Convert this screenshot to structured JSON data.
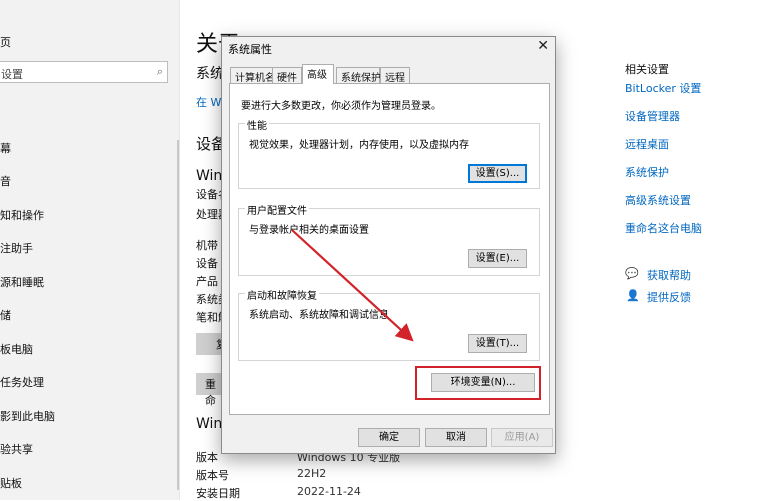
{
  "sidebar": {
    "page_frag": "页",
    "search_placeholder": "设置",
    "items": [
      "幕",
      "音",
      "知和操作",
      "注助手",
      "源和睡眠",
      "储",
      "板电脑",
      "任务处理",
      "影到此电脑",
      "验共享",
      "贴板"
    ]
  },
  "main": {
    "title_frag": "关于",
    "sub_frag": "系统",
    "link_frag": "在 Wi",
    "device_head": "设备",
    "spec_frag": "Win",
    "spec_rows": [
      "设备名",
      "处理器",
      "机带",
      "设备",
      "产品",
      "系统类",
      "笔和触"
    ],
    "copy_btn": "复",
    "rename_btn": "重命",
    "win_head": "Wind",
    "win_rows": [
      {
        "label": "版本",
        "value": "Windows 10 专业版"
      },
      {
        "label": "版本号",
        "value": "22H2"
      },
      {
        "label": "安装日期",
        "value": "2022-11-24"
      }
    ]
  },
  "right": {
    "heading": "相关设置",
    "links": [
      "BitLocker 设置",
      "设备管理器",
      "远程桌面",
      "系统保护",
      "高级系统设置",
      "重命名这台电脑"
    ],
    "help": "获取帮助",
    "feedback": "提供反馈"
  },
  "dialog": {
    "title": "系统属性",
    "close": "✕",
    "tabs": [
      "计算机名",
      "硬件",
      "高级",
      "系统保护",
      "远程"
    ],
    "active_tab": "高级",
    "admin_note": "要进行大多数更改，你必须作为管理员登录。",
    "groups": [
      {
        "label": "性能",
        "desc": "视觉效果，处理器计划，内存使用，以及虚拟内存",
        "button": "设置(S)..."
      },
      {
        "label": "用户配置文件",
        "desc": "与登录帐户相关的桌面设置",
        "button": "设置(E)..."
      },
      {
        "label": "启动和故障恢复",
        "desc": "系统启动、系统故障和调试信息",
        "button": "设置(T)..."
      }
    ],
    "env_button": "环境变量(N)...",
    "ok": "确定",
    "cancel": "取消",
    "apply": "应用(A)"
  },
  "colors": {
    "link": "#0067c0",
    "highlight_frame": "#d2232a",
    "arrow": "#d2232a"
  }
}
